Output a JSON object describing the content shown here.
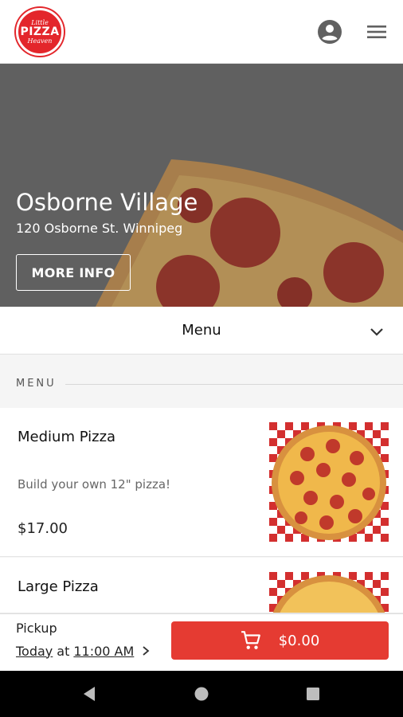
{
  "header": {
    "logo_top": "Little",
    "logo_main": "PIZZA",
    "logo_bottom": "Heaven",
    "account_icon": "account-circle-icon",
    "menu_icon": "hamburger-menu-icon"
  },
  "store": {
    "name": "Osborne Village",
    "address": "120 Osborne St. Winnipeg",
    "more_info_label": "MORE INFO"
  },
  "menu_selector": {
    "label": "Menu",
    "icon": "chevron-down-icon"
  },
  "section": {
    "title": "MENU"
  },
  "items": [
    {
      "name": "Medium Pizza",
      "description": "Build your own 12\" pizza!",
      "price": "$17.00"
    },
    {
      "name": "Large Pizza"
    }
  ],
  "bottom_bar": {
    "pickup_label": "Pickup",
    "day": "Today",
    "at": "at",
    "time": "11:00 AM",
    "cart_total": "$0.00",
    "cart_icon": "shopping-cart-icon"
  },
  "colors": {
    "brand_red": "#e3262b",
    "cart_button": "#e53b32",
    "header_bg": "#ffffff",
    "nav_bg": "#000000"
  }
}
